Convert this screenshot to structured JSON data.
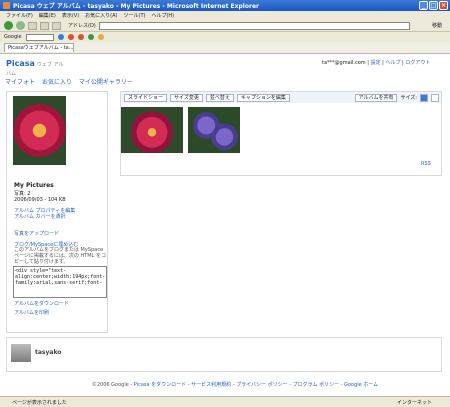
{
  "window": {
    "title": "Picasa ウェブ アルバム - tasyako - My Pictures - Microsoft Internet Explorer"
  },
  "menu": [
    "ファイル(F)",
    "編集(E)",
    "表示(V)",
    "お気に入り(A)",
    "ツール(T)",
    "ヘルプ(H)"
  ],
  "toolbar": {
    "address_label": "アドレス(D)",
    "go_label": "移動"
  },
  "toolbar2": {
    "google_label": "Google"
  },
  "tab": {
    "label": "Picasaウェブアルバム - ta..."
  },
  "picasa": {
    "logo": "Picasa",
    "tagline": "ウェブ アルバム"
  },
  "user": {
    "email": "ta***@gmail.com",
    "settings": "設定",
    "help": "ヘルプ",
    "logout": "ログアウト"
  },
  "nav": [
    "マイフォト",
    "お気に入り",
    "マイ公開ギャラリー"
  ],
  "album": {
    "title": "My Pictures",
    "count": "写真: 2",
    "date": "2006/09/03",
    "size": "104 KB",
    "edit_props": "アルバム プロパティを編集",
    "cover": "アルバム カバーを選択",
    "upload": "写真をアップロード",
    "myspace": "ブログ/MySpaceに埋め込む",
    "myspace_note": "このアルバムをブログまたは MySpace ページに掲載するには、次の HTML をコピーして貼り付けます。",
    "embed_code": "<div style=\"text-align:center;width:194px;font-family:arial,sans-serif;font-",
    "download": "アルバムをダウンロード",
    "print": "アルバムを印刷"
  },
  "buttons": {
    "slideshow": "スライドショー",
    "resize": "サイズ変更",
    "sort": "並べ替え",
    "captions": "キャプションを編集",
    "share": "アルバムを共有",
    "size_label": "サイズ:"
  },
  "rss": "RSS",
  "owner": {
    "name": "tasyako"
  },
  "footer": {
    "copyright": "©2006 Google",
    "links": [
      "Picasa をダウンロード",
      "サービス利用規約",
      "プライバシー ポリシー",
      "プログラム ポリシー",
      "Google ホーム"
    ]
  },
  "status": {
    "text": "ページが表示されました",
    "zone": "インターネット"
  }
}
